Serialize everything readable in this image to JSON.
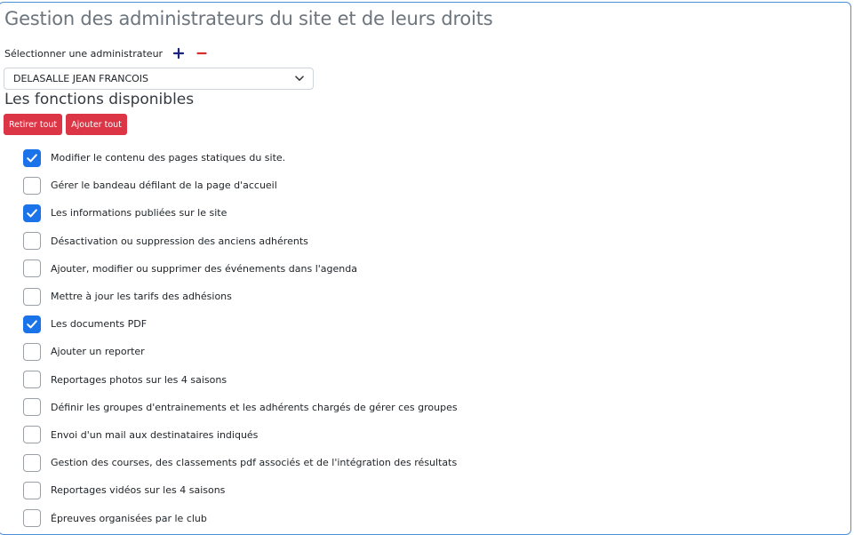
{
  "page": {
    "title": "Gestion des administrateurs du site et de leurs droits"
  },
  "admin_selector": {
    "label": "Sélectionner une administrateur",
    "add_icon": "plus-icon",
    "remove_icon": "minus-icon",
    "selected_value": "DELASALLE JEAN FRANCOIS"
  },
  "functions": {
    "title": "Les fonctions disponibles",
    "remove_all_label": "Retirer tout",
    "add_all_label": "Ajouter tout",
    "items": [
      {
        "label": "Modifier le contenu des pages statiques du site.",
        "checked": true
      },
      {
        "label": "Gérer le bandeau défilant de la page d'accueil",
        "checked": false
      },
      {
        "label": "Les informations publiées sur le site",
        "checked": true
      },
      {
        "label": "Désactivation ou suppression des anciens adhérents",
        "checked": false
      },
      {
        "label": "Ajouter, modifier ou supprimer des événements dans l'agenda",
        "checked": false
      },
      {
        "label": "Mettre à jour les tarifs des adhésions",
        "checked": false
      },
      {
        "label": "Les documents PDF",
        "checked": true
      },
      {
        "label": "Ajouter un reporter",
        "checked": false
      },
      {
        "label": "Reportages photos sur les 4 saisons",
        "checked": false
      },
      {
        "label": "Définir les groupes d'entrainements et les adhérents chargés de gérer ces groupes",
        "checked": false
      },
      {
        "label": "Envoi d'un mail aux destinataires indiqués",
        "checked": false
      },
      {
        "label": "Gestion des courses, des classements pdf associés et de l'intégration des résultats",
        "checked": false
      },
      {
        "label": "Reportages vidéos sur les 4 saisons",
        "checked": false
      },
      {
        "label": "Épreuves organisées par le club",
        "checked": false
      }
    ]
  },
  "colors": {
    "accent": "#1a73e8",
    "danger": "#dc3545",
    "plus": "#1a237e",
    "minus": "#d32f2f"
  }
}
